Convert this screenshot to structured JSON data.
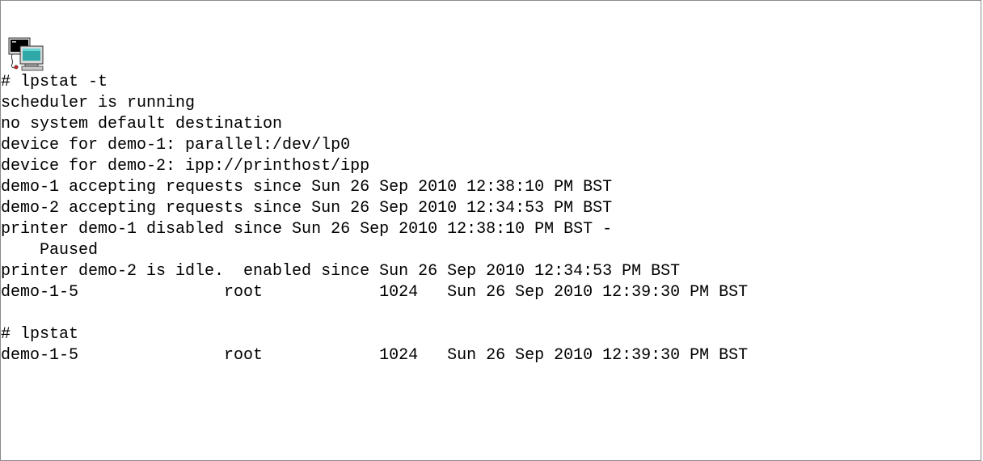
{
  "terminal": {
    "icon": "terminal-computer-icon",
    "lines": [
      "# lpstat -t",
      "scheduler is running",
      "no system default destination",
      "device for demo-1: parallel:/dev/lp0",
      "device for demo-2: ipp://printhost/ipp",
      "demo-1 accepting requests since Sun 26 Sep 2010 12:38:10 PM BST",
      "demo-2 accepting requests since Sun 26 Sep 2010 12:34:53 PM BST",
      "printer demo-1 disabled since Sun 26 Sep 2010 12:38:10 PM BST -",
      "Paused",
      "printer demo-2 is idle.  enabled since Sun 26 Sep 2010 12:34:53 PM BST",
      "demo-1-5               root            1024   Sun 26 Sep 2010 12:39:30 PM BST",
      "",
      "# lpstat",
      "demo-1-5               root            1024   Sun 26 Sep 2010 12:39:30 PM BST"
    ]
  }
}
